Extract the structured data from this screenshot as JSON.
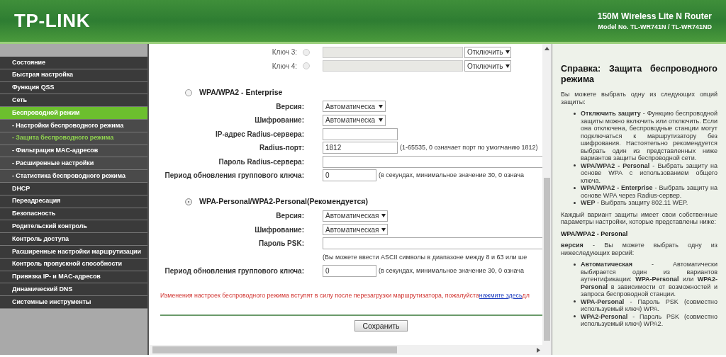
{
  "header": {
    "logo": "TP-LINK",
    "product": "150M Wireless Lite N Router",
    "model": "Model No. TL-WR741N / TL-WR741ND"
  },
  "sidebar": {
    "items": [
      {
        "label": "Состояние",
        "kind": "section",
        "selected": false
      },
      {
        "label": "Быстрая настройка",
        "kind": "section",
        "selected": false
      },
      {
        "label": "Функция QSS",
        "kind": "section",
        "selected": false
      },
      {
        "label": "Сеть",
        "kind": "section",
        "selected": false
      },
      {
        "label": "Беспроводной режим",
        "kind": "section",
        "selected": true
      },
      {
        "label": "- Настройки беспроводного режима",
        "kind": "subitem",
        "selected": false
      },
      {
        "label": "- Защита беспроводного режима",
        "kind": "subitem",
        "selected": true
      },
      {
        "label": "- Фильтрация MAC-адресов",
        "kind": "subitem",
        "selected": false
      },
      {
        "label": "- Расширенные настройки",
        "kind": "subitem",
        "selected": false
      },
      {
        "label": "- Статистика беспроводного режима",
        "kind": "subitem",
        "selected": false
      },
      {
        "label": "DHCP",
        "kind": "section",
        "selected": false
      },
      {
        "label": "Переадресация",
        "kind": "section",
        "selected": false
      },
      {
        "label": "Безопасность",
        "kind": "section",
        "selected": false
      },
      {
        "label": "Родительский контроль",
        "kind": "section",
        "selected": false
      },
      {
        "label": "Контроль доступа",
        "kind": "section",
        "selected": false
      },
      {
        "label": "Расширенные настройки маршрутизации",
        "kind": "section",
        "selected": false
      },
      {
        "label": "Контроль пропускной способности",
        "kind": "section",
        "selected": false
      },
      {
        "label": "Привязка IP- и MAC-адресов",
        "kind": "section",
        "selected": false
      },
      {
        "label": "Динамический DNS",
        "kind": "section",
        "selected": false
      },
      {
        "label": "Системные инструменты",
        "kind": "section",
        "selected": false
      }
    ]
  },
  "wep_keys": [
    {
      "label": "Ключ 3:",
      "selected": false,
      "type": "Отключить"
    },
    {
      "label": "Ключ 4:",
      "selected": false,
      "type": "Отключить"
    }
  ],
  "sections": [
    {
      "title": "WPA/WPA2 - Enterprise",
      "selected": false,
      "fields": [
        {
          "kind": "select",
          "label": "Версия:",
          "value": "Автоматическа"
        },
        {
          "kind": "select",
          "label": "Шифрование:",
          "value": "Автоматическа"
        },
        {
          "kind": "input",
          "label": "IP-адрес Radius-сервера:"
        },
        {
          "kind": "input",
          "label": "Radius-порт:",
          "value": "1812",
          "hint": "(1-65535, 0 означает порт по умолчанию 1812)"
        },
        {
          "kind": "wide",
          "label": "Пароль Radius-сервера:"
        },
        {
          "kind": "input",
          "label": "Период обновления группового ключа:",
          "value": "0",
          "hint": "(в секундах, минимальное значение 30, 0 означа"
        }
      ]
    },
    {
      "title": "WPA-Personal/WPA2-Personal(Рекомендуется)",
      "selected": true,
      "fields": [
        {
          "kind": "select",
          "label": "Версия:",
          "value": "Автоматическая"
        },
        {
          "kind": "select",
          "label": "Шифрование:",
          "value": "Автоматическая"
        },
        {
          "kind": "wide",
          "label": "Пароль PSK:"
        },
        {
          "kind": "note",
          "hint": "(Вы можете ввести ASCII символы в диапазоне между 8 и 63 или ше"
        },
        {
          "kind": "input",
          "label": "Период обновления группового ключа:",
          "value": "0",
          "hint": "(в секундах, минимальное значение 30, 0 означа"
        }
      ]
    }
  ],
  "notice": {
    "text": "Изменения настроек беспроводного режима вступят в силу после перезагрузки маршрутизатора, пожалуйста",
    "link": "нажмите здесь",
    "tail": "дл"
  },
  "save_button": "Сохранить",
  "help": {
    "title": "Справка: Защита беспроводного режима",
    "blocks": [
      {
        "kind": "para",
        "text": "Вы можете выбрать одну из следующих опций защиты:"
      },
      {
        "kind": "list",
        "items": [
          "**Отключить защиту** - Функцию беспроводной защиты можно включить или отключить. Если она отключена, беспроводные станции могут подключаться к маршрутизатору без шифрования. Настоятельно рекомендуется выбрать один из представленных ниже вариантов защиты беспроводной сети.",
          "**WPA/WPA2 - Personal** - Выбрать защиту на основе WPA с использованием общего ключа.",
          "**WPA/WPA2 - Enterprise** - Выбрать защиту на основе WPA через Radius-сервер.",
          "**WEP** - Выбрать защиту 802.11 WEP."
        ]
      },
      {
        "kind": "para",
        "text": "Каждый вариант защиты имеет свои собственные параметры настройки, которые представлены ниже:"
      },
      {
        "kind": "heading",
        "text": "WPA/WPA2 - Personal"
      },
      {
        "kind": "para",
        "text": "**версия** - Вы можете выбрать одну из нижеследующих версий:"
      },
      {
        "kind": "list",
        "items": [
          "**Автоматическая** - Автоматически выбирается один из вариантов аутентификации: **WPA-Personal** или **WPA2-Personal** в зависимости от возможностей и запроса беспроводной станции.",
          "**WPA-Personal** - Пароль PSK (совместно используемый ключ) WPA.",
          "**WPA2-Personal** - Пароль PSK (совместно используемый ключ) WPA2."
        ]
      }
    ]
  }
}
